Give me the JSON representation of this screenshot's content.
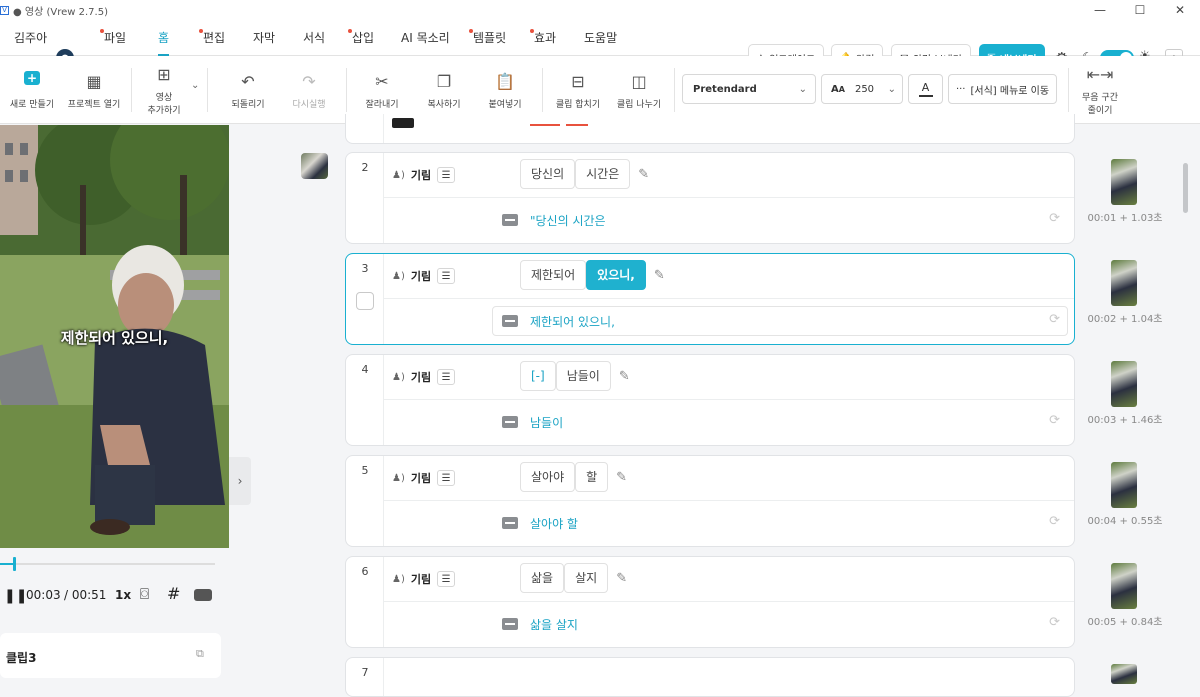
{
  "window": {
    "title": "● 영상 (Vrew 2.7.5)",
    "app_icon": "V"
  },
  "menu": {
    "user_name": "김주아",
    "items": [
      {
        "label": "파일",
        "dot": true
      },
      {
        "label": "홈",
        "active": true
      },
      {
        "label": "편집",
        "dot": true
      },
      {
        "label": "자막"
      },
      {
        "label": "서식"
      },
      {
        "label": "삽입",
        "dot": true
      },
      {
        "label": "AI 목소리"
      },
      {
        "label": "템플릿",
        "dot": true
      },
      {
        "label": "효과",
        "dot": true
      },
      {
        "label": "도움말"
      }
    ],
    "buttons": {
      "upgrade": "업그레이드",
      "alerts": "알림",
      "feedback": "의견 보내기",
      "export": "내보내기"
    }
  },
  "toolbar": {
    "new": "새로 만들기",
    "open": "프로젝트 열기",
    "add_video_1": "영상",
    "add_video_2": "추가하기",
    "undo": "되돌리기",
    "redo": "다시실행",
    "cut": "잘라내기",
    "copy": "복사하기",
    "paste": "붙여넣기",
    "merge": "클립 합치기",
    "split": "클립 나누기",
    "font": "Pretendard",
    "font_size": "250",
    "format_menu": "[서식] 메뉴로 이동",
    "silence_1": "무음 구간",
    "silence_2": "줄이기"
  },
  "player": {
    "caption": "제한되어 있으니,",
    "current_time": "00:03",
    "total_time": "/ 00:51",
    "speed": "1x",
    "progress": 0.06
  },
  "clip_panel": {
    "title": "클립3"
  },
  "clips": [
    {
      "num": "2",
      "speaker": "기림",
      "words": [
        "당신의",
        "시간은"
      ],
      "subtitle": "\"당신의 시간은",
      "time": "00:01 + 1.03초"
    },
    {
      "num": "3",
      "speaker": "기림",
      "words": [
        "제한되어",
        "있으니,"
      ],
      "highlight": 1,
      "subtitle": "제한되어 있으니,",
      "time": "00:02 + 1.04초",
      "selected": true
    },
    {
      "num": "4",
      "speaker": "기림",
      "words": [
        "[-]",
        "남들이"
      ],
      "subtitle": "남들이",
      "time": "00:03 + 1.46초"
    },
    {
      "num": "5",
      "speaker": "기림",
      "words": [
        "살아야",
        "할"
      ],
      "subtitle": "살아야 할",
      "time": "00:04 + 0.55초"
    },
    {
      "num": "6",
      "speaker": "기림",
      "words": [
        "삶을",
        "살지"
      ],
      "subtitle": "삶을 살지",
      "time": "00:05 + 0.84초"
    },
    {
      "num": "7",
      "speaker": "",
      "words": [],
      "subtitle": "",
      "time": ""
    }
  ],
  "colors": {
    "accent": "#19b0d0",
    "menu_dot": "#e8523e"
  }
}
